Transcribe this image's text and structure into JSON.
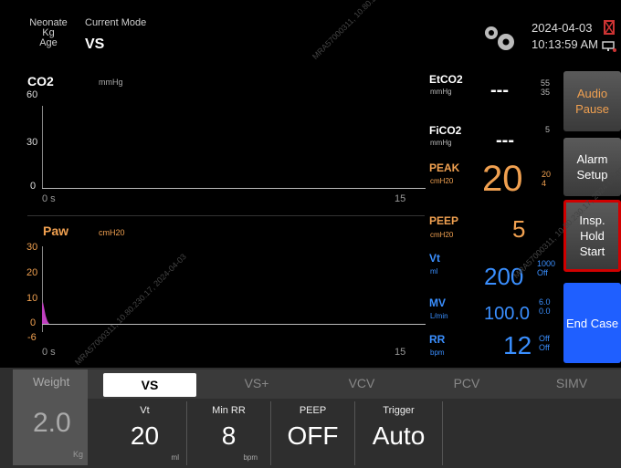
{
  "header": {
    "patient_type": "Neonate",
    "weight_unit": "Kg",
    "age_label": "Age",
    "current_mode_label": "Current Mode",
    "current_mode": "VS",
    "date": "2024-04-03",
    "time": "10:13:59 AM",
    "icons": [
      "gear-icon",
      "alarm-silenced-icon",
      "network-icon"
    ]
  },
  "co2_wave": {
    "title": "CO2",
    "unit": "mmHg",
    "y_ticks": [
      "60",
      "30",
      "0"
    ],
    "x_start": "0 s",
    "x_end": "15"
  },
  "paw_wave": {
    "title": "Paw",
    "unit": "cmH20",
    "y_ticks": [
      "30",
      "20",
      "10",
      "0",
      "-6"
    ],
    "x_start": "0 s",
    "x_end": "15"
  },
  "parameters": {
    "etco2": {
      "label": "EtCO2",
      "unit": "mmHg",
      "value": "---",
      "high": "55",
      "low": "35"
    },
    "fico2": {
      "label": "FiCO2",
      "unit": "mmHg",
      "value": "---",
      "high": "5"
    },
    "peak": {
      "label": "PEAK",
      "unit": "cmH20",
      "value": "20",
      "high": "20",
      "low": "4"
    },
    "peep": {
      "label": "PEEP",
      "unit": "cmH20",
      "value": "5"
    },
    "vt": {
      "label": "Vt",
      "unit": "ml",
      "value": "200",
      "high": "1000",
      "low": "Off"
    },
    "mv": {
      "label": "MV",
      "unit": "L/min",
      "value": "100.0",
      "high": "6.0",
      "low": "0.0"
    },
    "rr": {
      "label": "RR",
      "unit": "bpm",
      "value": "12",
      "high": "Off",
      "low": "Off"
    }
  },
  "side_buttons": {
    "audio_pause": "Audio Pause",
    "alarm_setup": "Alarm Setup",
    "insp_hold": "Insp. Hold Start",
    "end_case": "End Case"
  },
  "bottom": {
    "weight_label": "Weight",
    "weight_value": "2.0",
    "weight_unit": "Kg",
    "tabs": [
      "VS",
      "VS+",
      "VCV",
      "PCV",
      "SIMV"
    ],
    "active_tab": "VS",
    "settings": [
      {
        "name": "Vt",
        "value": "20",
        "unit": "ml"
      },
      {
        "name": "Min RR",
        "value": "8",
        "unit": "bpm"
      },
      {
        "name": "PEEP",
        "value": "OFF",
        "unit": ""
      },
      {
        "name": "Trigger",
        "value": "Auto",
        "unit": ""
      }
    ]
  },
  "watermark": "MRA57000311, 10.80.230.17, 2024-04-03",
  "colors": {
    "accent_orange": "#f0a050",
    "accent_blue": "#3a8fff",
    "paw_wave": "#c040c0",
    "end_case_blue": "#1f5fff",
    "insp_hold_border": "#d00000"
  }
}
